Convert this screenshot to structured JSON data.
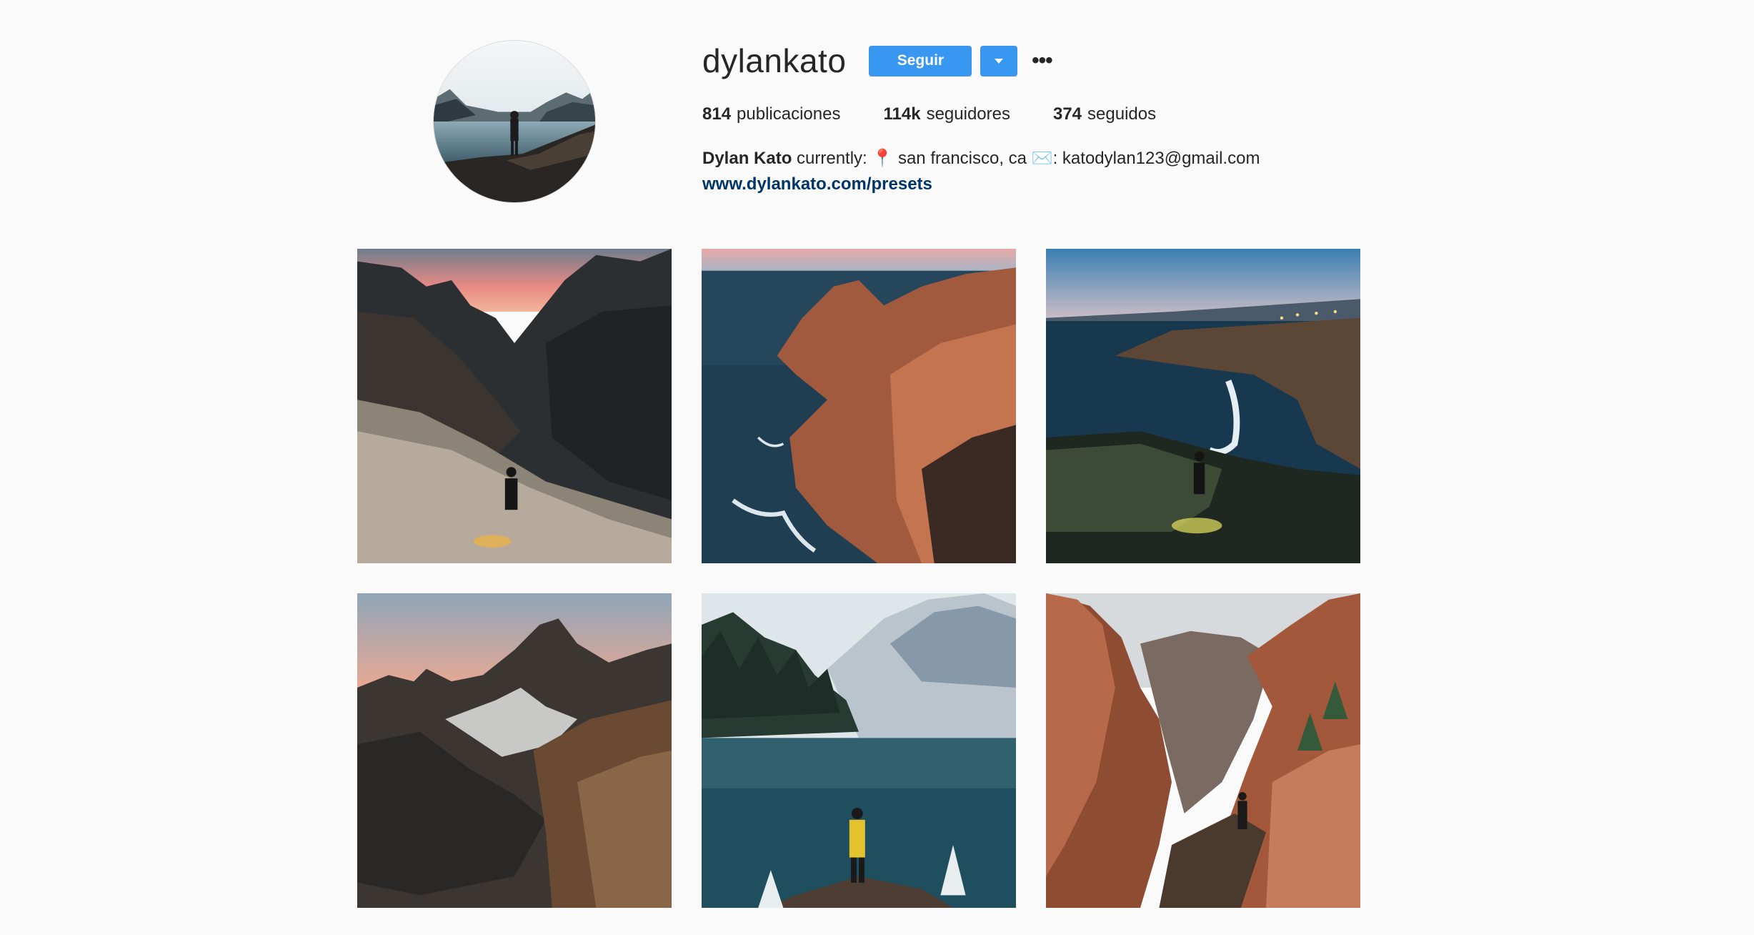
{
  "profile": {
    "username": "dylankato",
    "follow_label": "Seguir",
    "dropdown_icon": "caret-down-icon",
    "more_label": "•••",
    "avatar_alt": "profile-photo"
  },
  "stats": [
    {
      "count": "814",
      "label": "publicaciones"
    },
    {
      "count": "114k",
      "label": "seguidores"
    },
    {
      "count": "374",
      "label": "seguidos"
    }
  ],
  "bio": {
    "name": "Dylan Kato",
    "text_before": " currently: ",
    "pin_icon": "📍",
    "location": " san francisco, ca ",
    "mail_icon": "✉️",
    "email_text": ": katodylan123@gmail.com",
    "link": "www.dylankato.com/presets"
  },
  "colors": {
    "accent": "#3897f0",
    "link": "#003569",
    "background": "#fafafa",
    "text": "#262626"
  }
}
